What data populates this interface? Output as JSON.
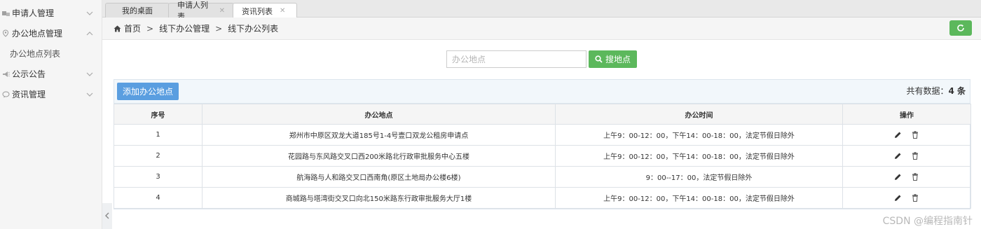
{
  "sidebar": {
    "items": [
      {
        "label": "申请人管理",
        "icon": "users-icon",
        "expanded": false
      },
      {
        "label": "办公地点管理",
        "icon": "map-pin-icon",
        "expanded": true
      },
      {
        "label": "办公地点列表",
        "icon": "",
        "sub": true
      },
      {
        "label": "公示公告",
        "icon": "megaphone-icon",
        "expanded": false
      },
      {
        "label": "资讯管理",
        "icon": "chat-icon",
        "expanded": false
      }
    ]
  },
  "tabs": [
    {
      "label": "我的桌面",
      "closable": false
    },
    {
      "label": "申请人列表",
      "closable": true
    },
    {
      "label": "资讯列表",
      "closable": true,
      "active": true
    }
  ],
  "breadcrumb": {
    "home": "首页",
    "level1": "线下办公管理",
    "level2": "线下办公列表"
  },
  "search": {
    "placeholder": "办公地点",
    "button_label": "搜地点"
  },
  "panel": {
    "add_label": "添加办公地点",
    "total_prefix": "共有数据：",
    "total_count": "4",
    "total_suffix": " 条"
  },
  "table": {
    "columns": [
      "序号",
      "办公地点",
      "办公时间",
      "操作"
    ],
    "rows": [
      [
        "1",
        "郑州市中原区双龙大道185号1-4号壹口双龙公租房申请点",
        "上午9：00-12：00，下午14：00-18：00，法定节假日除外"
      ],
      [
        "2",
        "花园路与东风路交叉口西200米路北行政审批服务中心五楼",
        "上午9：00-12：00，下午14：00-18：00，法定节假日除外"
      ],
      [
        "3",
        "航海路与人和路交叉口西南角(原区土地局办公楼6楼)",
        "9：00--17：00，法定节假日除外"
      ],
      [
        "4",
        "商城路与塔湾街交叉口向北150米路东行政审批服务大厅1楼",
        "上午9：00-12：00，下午14：00-18：00，法定节假日除外"
      ]
    ]
  },
  "colors": {
    "green": "#5cb85c",
    "blue": "#5a9ee0"
  },
  "watermark": "CSDN @编程指南针"
}
